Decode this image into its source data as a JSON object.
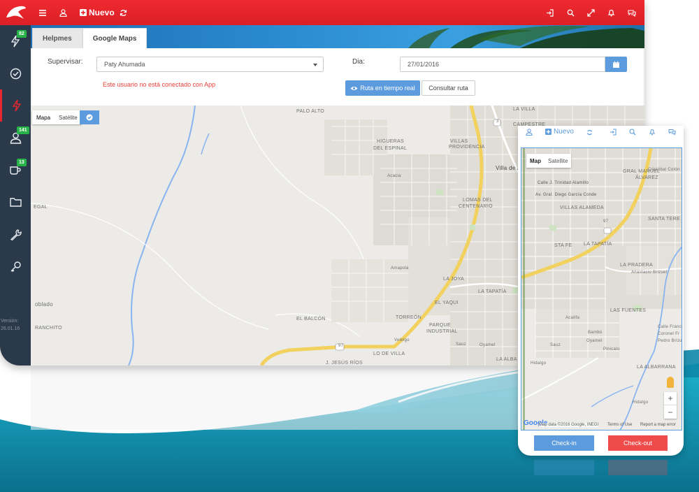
{
  "topbar": {
    "new_label": "Nuevo",
    "icons_left": [
      "menu-icon",
      "user-icon",
      "plus-square-icon",
      "refresh-icon"
    ],
    "icons_right": [
      "sign-in-icon",
      "search-icon",
      "expand-icon",
      "bell-icon",
      "chat-icon"
    ]
  },
  "sidebar": {
    "items": [
      {
        "icon": "bolt-icon",
        "badge": "82"
      },
      {
        "icon": "check-circle-icon",
        "badge": ""
      },
      {
        "icon": "bolt-icon",
        "badge": "",
        "active": true
      },
      {
        "icon": "user-icon",
        "badge": "141"
      },
      {
        "icon": "coffee-icon",
        "badge": "13"
      },
      {
        "icon": "folder-icon",
        "badge": ""
      },
      {
        "icon": "wrench-icon",
        "badge": ""
      },
      {
        "icon": "key-icon",
        "badge": ""
      }
    ],
    "version_label": "Versión:",
    "version_value": "26.01.16"
  },
  "tabs": [
    {
      "label": "Helpmes",
      "active": false
    },
    {
      "label": "Google Maps",
      "active": true
    }
  ],
  "form": {
    "supervisor_label": "Supervisar:",
    "supervisor_value": "Paty Ahumada",
    "day_label": "Dia:",
    "day_value": "27/01/2016",
    "warning": "Este usuario no está conectado con App",
    "realtime_button": "Ruta en tiempo real",
    "consult_button": "Consultar ruta"
  },
  "map": {
    "type_map": "Mapa",
    "type_satellite": "Satélite",
    "labels": {
      "palo_alto": "PALO ALTO",
      "higueras": "HIGUERAS",
      "del_espinal": "DEL ESPINAL",
      "villas_providencia_1": "VILLAS",
      "villas_providencia_2": "PROVIDENCIA",
      "villa_de_alvarez": "Villa de Álvarez",
      "lomas": "LOMAS DEL",
      "centenario": "CENTENARIO",
      "la_joya": "LA JOYA",
      "torreon": "TORREÓN",
      "el_yaqui": "EL YAQUI",
      "la_tapatia": "LA TAPATÍA",
      "parque_industrial_1": "PARQUE",
      "parque_industrial_2": "INDUSTRIAL",
      "el_balcon": "EL BALCÓN",
      "jesus_rios": "J. JESÚS RÍOS",
      "lo_de_villa": "LO DE VILLA",
      "la_villa": "LA VILLA",
      "campestre": "CAMPESTRE",
      "oblado": "oblado",
      "rancho": "RANCHITO",
      "egal": "EGAL",
      "la_alba": "LA ALBA",
      "route_97": "97",
      "route_3": "3",
      "acacia": "Acacia",
      "amapola": "Amapola",
      "oyamel": "Oyamel",
      "sauz": "Sauz",
      "velelgo": "Velelgo"
    }
  },
  "phone": {
    "new_label": "Nuevo",
    "type_map": "Map",
    "type_satellite": "Satellite",
    "labels": {
      "manuel_alvarez_1": "GRAL MANUEL",
      "manuel_alvarez_2": "ÁLVAREZ",
      "diego_conde": "Av. Gral. Diego García Conde",
      "tranquilino": "Calle J. Trinidad Alamillo",
      "villas_alameda": "VILLAS ALAMEDA",
      "santa_teresa": "SANTA TERE",
      "la_tapatia": "LA TAPATÍA",
      "sta_fe": "STA FE",
      "la_pradera": "LA PRADERA",
      "anastacio": "Anastacio Brizuel",
      "las_fuentes": "LAS FUENTES",
      "acalifa": "Acalifa",
      "bambu": "Bambú",
      "oyamel": "Oyamel",
      "sauz": "Sauz",
      "pinicato": "Pinicato",
      "hidalgo": "Hidalgo",
      "la_albarrana": "LA ALBARRANA",
      "hidalgo2": "Hidalgo",
      "route_97": "97",
      "calle_francia": "Calle Franci",
      "coronel": "Coronel Fr",
      "pedro_brizuela": "Pedro Brizu",
      "cristobal": "Cristóbal Colón"
    },
    "footer_google": "Google",
    "footer_data": "Map data ©2016 Google, INEGI",
    "footer_terms": "Terms of Use",
    "footer_report": "Report a map error",
    "checkin": "Check-in",
    "checkout": "Check-out"
  },
  "colors": {
    "topbar": "#e8262d",
    "sidebar": "#2b3a4a",
    "accent_blue": "#5b9bde",
    "danger": "#ef4b4b",
    "badge_green": "#27b348"
  }
}
